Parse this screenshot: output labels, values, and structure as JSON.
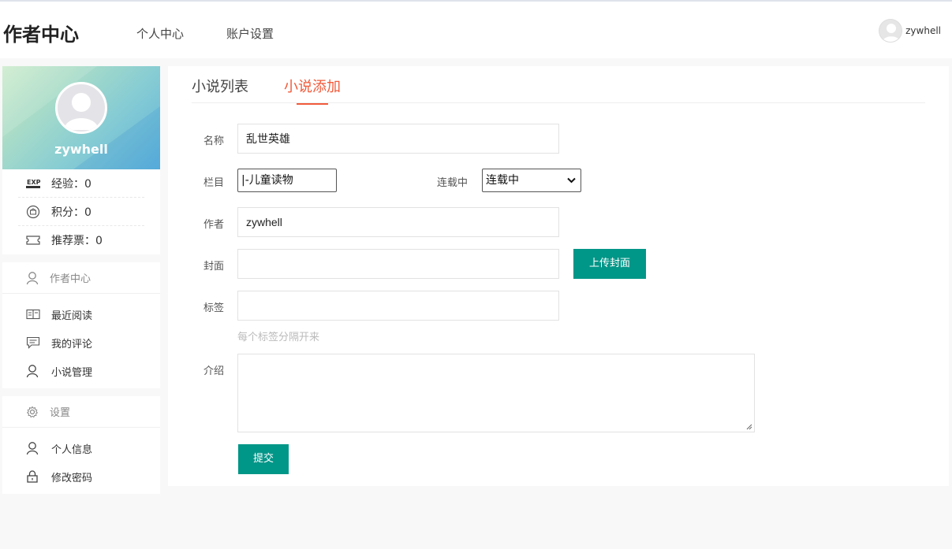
{
  "header": {
    "brand": "作者中心",
    "nav": [
      "个人中心",
      "账户设置"
    ],
    "username": "zywhell"
  },
  "sidebar": {
    "username": "zywhell",
    "stats": [
      {
        "label": "经验：0",
        "icon": "exp-icon"
      },
      {
        "label": "积分：0",
        "icon": "points-icon"
      },
      {
        "label": "推荐票：0",
        "icon": "ticket-icon"
      }
    ],
    "groups": [
      {
        "title": "作者中心",
        "icon": "user-icon",
        "items": [
          {
            "label": "最近阅读",
            "icon": "book-icon"
          },
          {
            "label": "我的评论",
            "icon": "comment-icon"
          },
          {
            "label": "小说管理",
            "icon": "user-icon"
          }
        ]
      },
      {
        "title": "设置",
        "icon": "gear-icon",
        "items": [
          {
            "label": "个人信息",
            "icon": "user-icon"
          },
          {
            "label": "修改密码",
            "icon": "lock-icon"
          }
        ]
      }
    ]
  },
  "tabs": [
    {
      "label": "小说列表",
      "active": false
    },
    {
      "label": "小说添加",
      "active": true
    }
  ],
  "form": {
    "name_label": "名称",
    "name_value": "乱世英雄",
    "category_label": "栏目",
    "category_value": "|-儿童读物",
    "status_label": "连载中",
    "status_value": "连载中",
    "author_label": "作者",
    "author_value": "zywhell",
    "cover_label": "封面",
    "cover_value": "",
    "upload_label": "上传封面",
    "tags_label": "标签",
    "tags_value": "",
    "tags_hint": "每个标签分隔开来",
    "intro_label": "介绍",
    "submit_label": "提交"
  },
  "colors": {
    "accent": "#009688",
    "active_tab": "#f15a3a"
  }
}
